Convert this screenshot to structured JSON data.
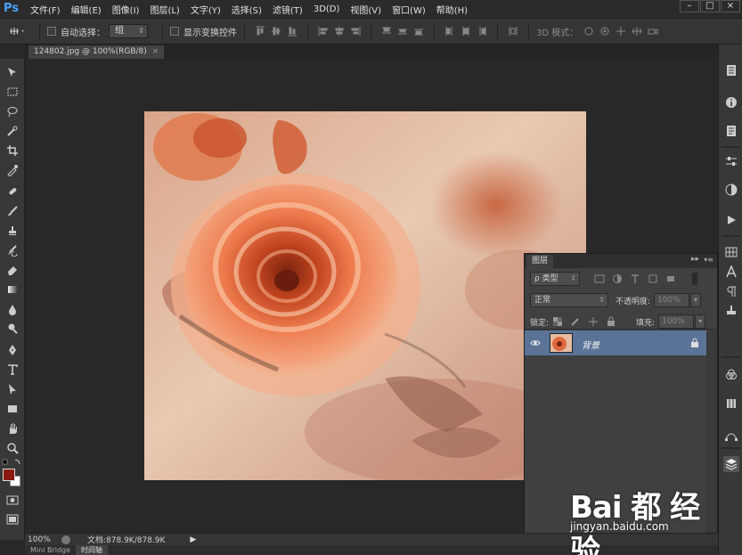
{
  "app": {
    "logo": "Ps"
  },
  "menu": [
    "文件(F)",
    "编辑(E)",
    "图像(I)",
    "图层(L)",
    "文字(Y)",
    "选择(S)",
    "滤镜(T)",
    "3D(D)",
    "视图(V)",
    "窗口(W)",
    "帮助(H)"
  ],
  "options": {
    "auto_select_label": "自动选择：",
    "auto_select_value": "组",
    "show_transform_label": "显示变换控件",
    "mode_3d_label": "3D 模式："
  },
  "document": {
    "tab_title": "124802.jpg @ 100%(RGB/8)",
    "tab_close": "×"
  },
  "status": {
    "zoom": "100%",
    "doc_size": "文档:878.9K/878.9K",
    "bottom_tabs": [
      "Mini Bridge",
      "时间轴"
    ]
  },
  "layers_panel": {
    "title": "图层",
    "filter_kind": "ρ 类型",
    "blend_mode": "正常",
    "opacity_label": "不透明度:",
    "opacity_value": "100%",
    "lock_label": "锁定:",
    "fill_label": "填充:",
    "fill_value": "100%",
    "layers": [
      {
        "name": "背景",
        "visible": true,
        "locked": true
      }
    ]
  },
  "watermark": {
    "logo": "Bai 都 经验",
    "url": "jingyan.baidu.com"
  },
  "colors": {
    "foreground": "#8b1a10",
    "background": "#ffffff",
    "selected_layer": "#5a7396"
  }
}
